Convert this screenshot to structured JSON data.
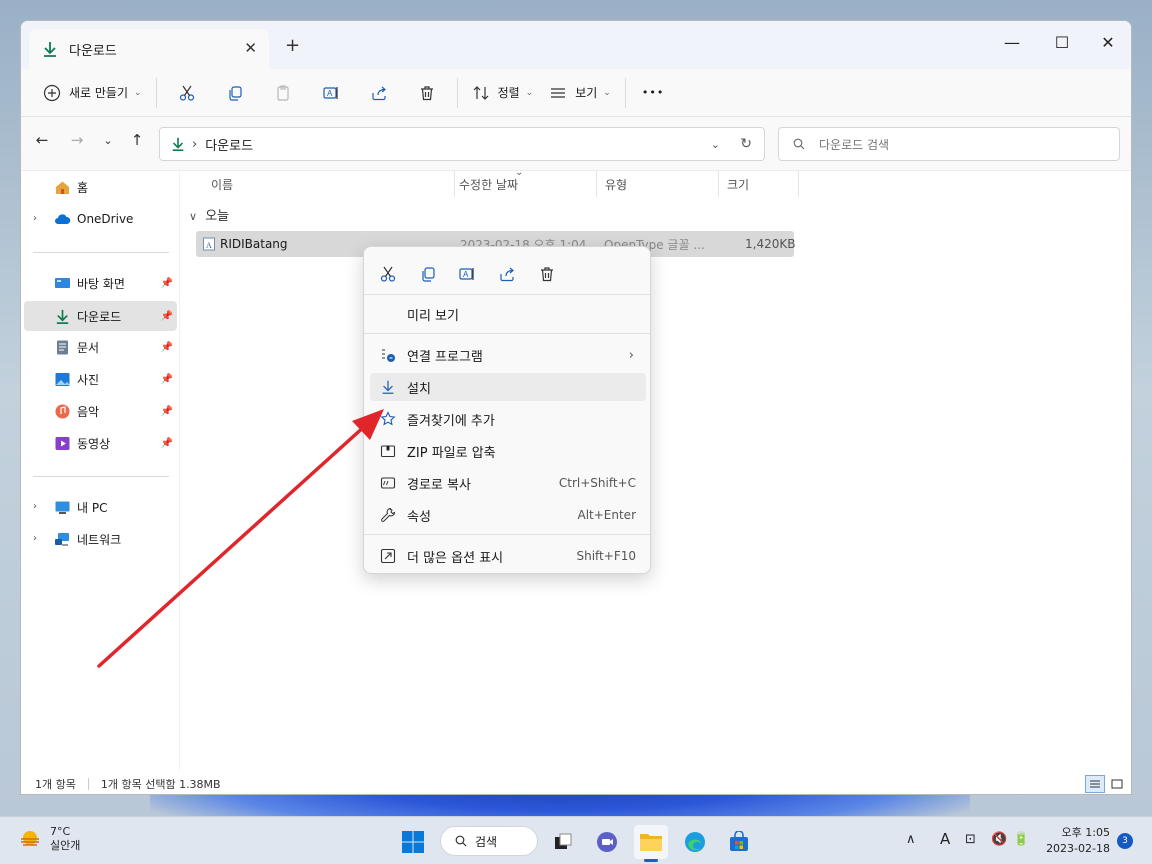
{
  "window": {
    "tab_title": "다운로드",
    "new_tab_label": "+",
    "close_tab_label": "✕",
    "minimize_label": "—",
    "maximize_label": "☐",
    "close_label": "✕"
  },
  "toolbar": {
    "new_label": "새로 만들기",
    "sort_label": "정렬",
    "view_label": "보기",
    "more_label": "•••"
  },
  "address": {
    "path": "다운로드",
    "search_placeholder": "다운로드 검색"
  },
  "sidebar": {
    "items": [
      {
        "label": "홈",
        "icon": "home-icon"
      },
      {
        "label": "OneDrive",
        "icon": "cloud-icon"
      },
      {
        "label": "바탕 화면",
        "icon": "desktop-icon"
      },
      {
        "label": "다운로드",
        "icon": "download-icon"
      },
      {
        "label": "문서",
        "icon": "document-icon"
      },
      {
        "label": "사진",
        "icon": "picture-icon"
      },
      {
        "label": "음악",
        "icon": "music-icon"
      },
      {
        "label": "동영상",
        "icon": "video-icon"
      },
      {
        "label": "내 PC",
        "icon": "pc-icon"
      },
      {
        "label": "네트워크",
        "icon": "network-icon"
      }
    ]
  },
  "columns": {
    "name": "이름",
    "modified": "수정한 날짜",
    "type": "유형",
    "size": "크기"
  },
  "group": {
    "label": "오늘"
  },
  "file": {
    "name": "RIDIBatang",
    "modified": "2023-02-18 오후 1:04",
    "type": "OpenType 글꼴 ...",
    "size": "1,420KB"
  },
  "context_menu": {
    "items": [
      {
        "label": "미리 보기",
        "shortcut": ""
      },
      {
        "label": "연결 프로그램",
        "shortcut": ""
      },
      {
        "label": "설치",
        "shortcut": ""
      },
      {
        "label": "즐겨찾기에 추가",
        "shortcut": ""
      },
      {
        "label": "ZIP 파일로 압축",
        "shortcut": ""
      },
      {
        "label": "경로로 복사",
        "shortcut": "Ctrl+Shift+C"
      },
      {
        "label": "속성",
        "shortcut": "Alt+Enter"
      },
      {
        "label": "더 많은 옵션 표시",
        "shortcut": "Shift+F10"
      }
    ],
    "submenu_glyph": "›"
  },
  "status": {
    "item_count": "1개 항목",
    "selection": "1개 항목 선택함 1.38MB"
  },
  "taskbar": {
    "weather_temp": "7°C",
    "weather_desc": "실안개",
    "search_label": "검색",
    "time": "오후 1:05",
    "date": "2023-02-18",
    "notification_count": "3"
  },
  "colors": {
    "accent": "#0f7a4f",
    "annotation_arrow": "#e0262a",
    "selection_bg": "#d8d8d8"
  }
}
